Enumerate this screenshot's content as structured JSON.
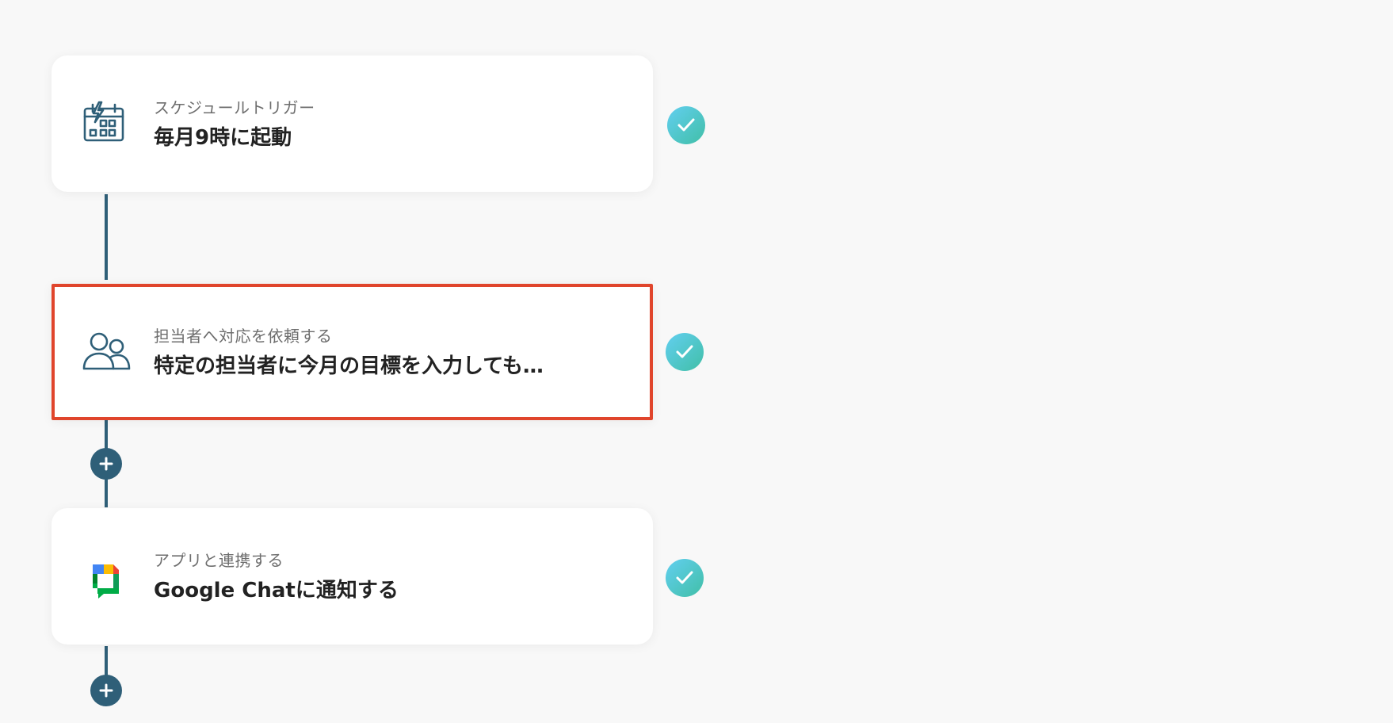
{
  "flow": {
    "steps": [
      {
        "subtitle": "スケジュールトリガー",
        "title": "毎月9時に起動",
        "icon": "calendar-trigger-icon",
        "status": "completed"
      },
      {
        "subtitle": "担当者へ対応を依頼する",
        "title": "特定の担当者に今月の目標を入力しても…",
        "icon": "people-icon",
        "status": "completed",
        "selected": true
      },
      {
        "subtitle": "アプリと連携する",
        "title": "Google Chatに通知する",
        "icon": "google-chat-icon",
        "status": "completed"
      }
    ]
  },
  "colors": {
    "background": "#f8f8f8",
    "connector": "#2f5f78",
    "selected_border": "#e0452c",
    "check_gradient_start": "#62cff0",
    "check_gradient_end": "#41bfa7",
    "icon_stroke": "#2f5f78"
  }
}
